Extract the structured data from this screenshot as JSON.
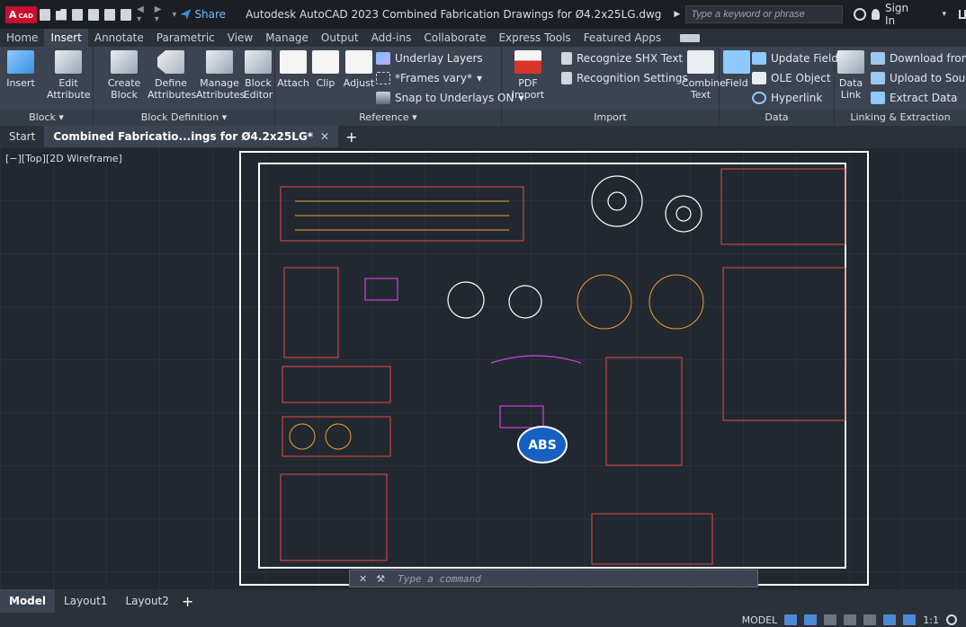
{
  "titlebar": {
    "logo": "A",
    "logo_sub": "CAD",
    "share": "Share",
    "title": "Autodesk AutoCAD 2023   Combined Fabrication Drawings for Ø4.2x25LG.dwg",
    "search_placeholder": "Type a keyword or phrase",
    "signin": "Sign In"
  },
  "ribbon_tabs": [
    "Home",
    "Insert",
    "Annotate",
    "Parametric",
    "View",
    "Manage",
    "Output",
    "Add-ins",
    "Collaborate",
    "Express Tools",
    "Featured Apps"
  ],
  "ribbon": {
    "block": {
      "title": "Block ▾",
      "insert": "Insert",
      "edit_attr": "Edit\nAttribute"
    },
    "blockdef": {
      "title": "Block Definition ▾",
      "create": "Create\nBlock",
      "define": "Define\nAttributes",
      "manage": "Manage\nAttributes",
      "editor": "Block\nEditor"
    },
    "reference": {
      "title": "Reference ▾",
      "attach": "Attach",
      "clip": "Clip",
      "adjust": "Adjust",
      "underlay": "Underlay Layers",
      "frames": "*Frames vary*",
      "snap": "Snap to Underlays ON"
    },
    "import": {
      "title": "Import",
      "pdf": "PDF\nImport",
      "shx": "Recognize SHX Text",
      "recog": "Recognition Settings",
      "combine": "Combine\nText"
    },
    "data": {
      "title": "Data",
      "field": "Field",
      "update": "Update Fields",
      "ole": "OLE Object",
      "hyperlink": "Hyperlink"
    },
    "linking": {
      "title": "Linking & Extraction",
      "datalink": "Data\nLink",
      "download": "Download from",
      "upload": "Upload to Source",
      "extract": "Extract  Data"
    }
  },
  "doctabs": {
    "start": "Start",
    "active": "Combined Fabricatio...ings for Ø4.2x25LG*"
  },
  "viewport": {
    "label": "[−][Top][2D Wireframe]",
    "logo": "ABS"
  },
  "command": {
    "placeholder": "Type a command"
  },
  "layouts": [
    "Model",
    "Layout1",
    "Layout2"
  ],
  "status": {
    "model": "MODEL",
    "scale": "1:1"
  },
  "colors": {
    "accent": "#3b8dde",
    "logo": "#c8102e"
  }
}
